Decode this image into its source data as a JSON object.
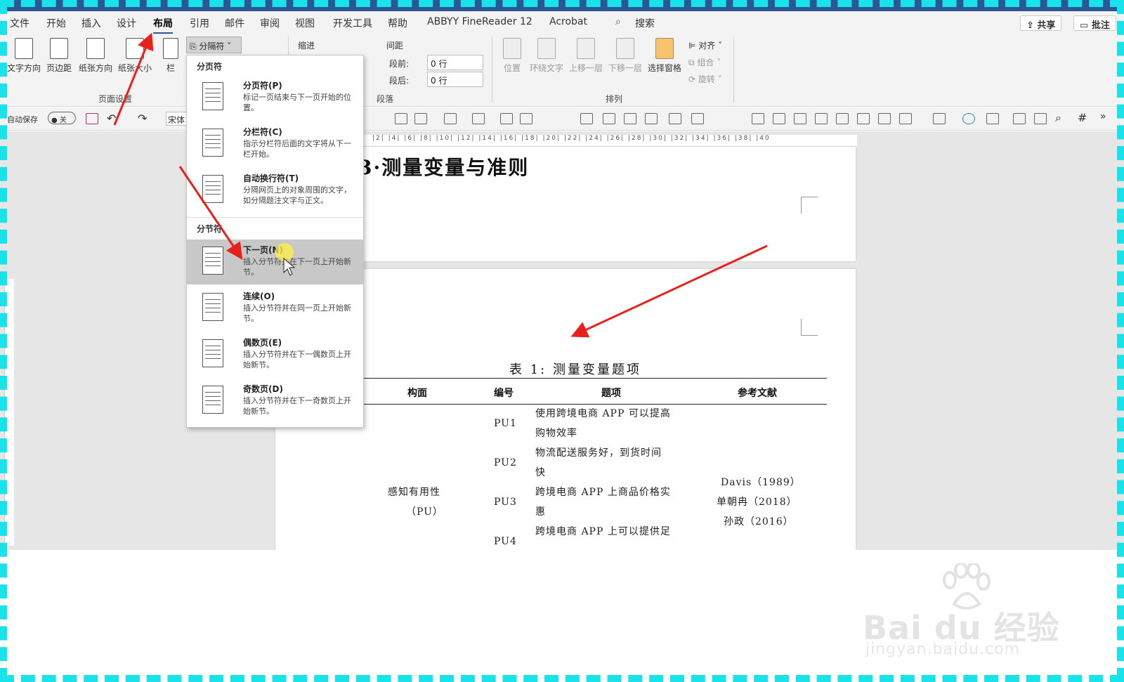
{
  "menu": {
    "items": [
      "文件",
      "开始",
      "插入",
      "设计",
      "布局",
      "引用",
      "邮件",
      "审阅",
      "视图",
      "开发工具",
      "帮助",
      "ABBYY FineReader 12",
      "Acrobat"
    ],
    "active": "布局",
    "search_label": "搜索",
    "share_label": "共享",
    "comment_label": "批注"
  },
  "ribbon": {
    "page_setup": {
      "text_direction": "文字方向",
      "margins": "页边距",
      "orientation": "纸张方向",
      "size": "纸张大小",
      "columns": "栏",
      "group_label": "页面设置",
      "breaks_label": "分隔符"
    },
    "paragraph": {
      "indent_label": "缩进",
      "spacing_label": "间距",
      "before_label": "段前:",
      "before_value": "0 行",
      "after_label": "段后:",
      "after_value": "0 行",
      "group_label": "段落"
    },
    "arrange": {
      "position": "位置",
      "wrap_text": "环绕文字",
      "bring_forward": "上移一层",
      "send_backward": "下移一层",
      "selection_pane": "选择窗格",
      "align": "对齐",
      "group": "组合",
      "rotate": "旋转",
      "group_label": "排列"
    }
  },
  "qat": {
    "autosave_label": "自动保存",
    "autosave_state": "关",
    "font_name": "宋体"
  },
  "breaks_menu": {
    "page_breaks_header": "分页符",
    "section_breaks_header": "分节符",
    "items": [
      {
        "title": "分页符(P)",
        "desc": "标记一页结束与下一页开始的位置。",
        "icon": "page-break-icon"
      },
      {
        "title": "分栏符(C)",
        "desc": "指示分栏符后面的文字将从下一栏开始。",
        "icon": "column-break-icon"
      },
      {
        "title": "自动换行符(T)",
        "desc": "分隔网页上的对象周围的文字，如分隔题注文字与正文。",
        "icon": "text-wrapping-break-icon"
      },
      {
        "title": "下一页(N)",
        "desc": "插入分节符并在下一页上开始新节。",
        "icon": "next-page-section-icon",
        "selected": true
      },
      {
        "title": "连续(O)",
        "desc": "插入分节符并在同一页上开始新节。",
        "icon": "continuous-section-icon"
      },
      {
        "title": "偶数页(E)",
        "desc": "插入分节符并在下一偶数页上开始新节。",
        "icon": "even-page-section-icon"
      },
      {
        "title": "奇数页(D)",
        "desc": "插入分节符并在下一奇数页上开始新节。",
        "icon": "odd-page-section-icon"
      }
    ]
  },
  "ruler": {
    "ticks": "|2|  |4|  |6|  |8|  |10|  |12|  |14|  |16|  |18|  |20|  |22|  |24|  |26|  |28|  |30|  |32|  |34|  |36|  |38|  |40"
  },
  "document": {
    "heading": "3·测量变量与准则",
    "table_caption": "表 1: 测量变量题项",
    "columns": [
      "构面",
      "编号",
      "题项",
      "参考文献"
    ],
    "construct": [
      "感知有用性",
      "（PU）"
    ],
    "rows": [
      {
        "id": "PU1",
        "item": [
          "使用跨境电商 APP 可以提高",
          "购物效率"
        ]
      },
      {
        "id": "PU2",
        "item": [
          "物流配送服务好，到货时间",
          "快"
        ]
      },
      {
        "id": "PU3",
        "item": [
          "跨境电商 APP 上商品价格实",
          "惠"
        ]
      },
      {
        "id": "PU4",
        "item": [
          "跨境电商 APP 上可以提供足",
          ""
        ]
      }
    ],
    "references": [
      "Davis（1989）",
      "单朝冉（2018）",
      "孙政（2016）"
    ]
  },
  "watermark": {
    "brand": "Bai du 经验",
    "url": "jingyan.baidu.com"
  },
  "colors": {
    "accent": "#2b579a",
    "frame": "#17e3e8",
    "annotation_arrow": "#e8201a",
    "selection": "#c8c8c8"
  }
}
